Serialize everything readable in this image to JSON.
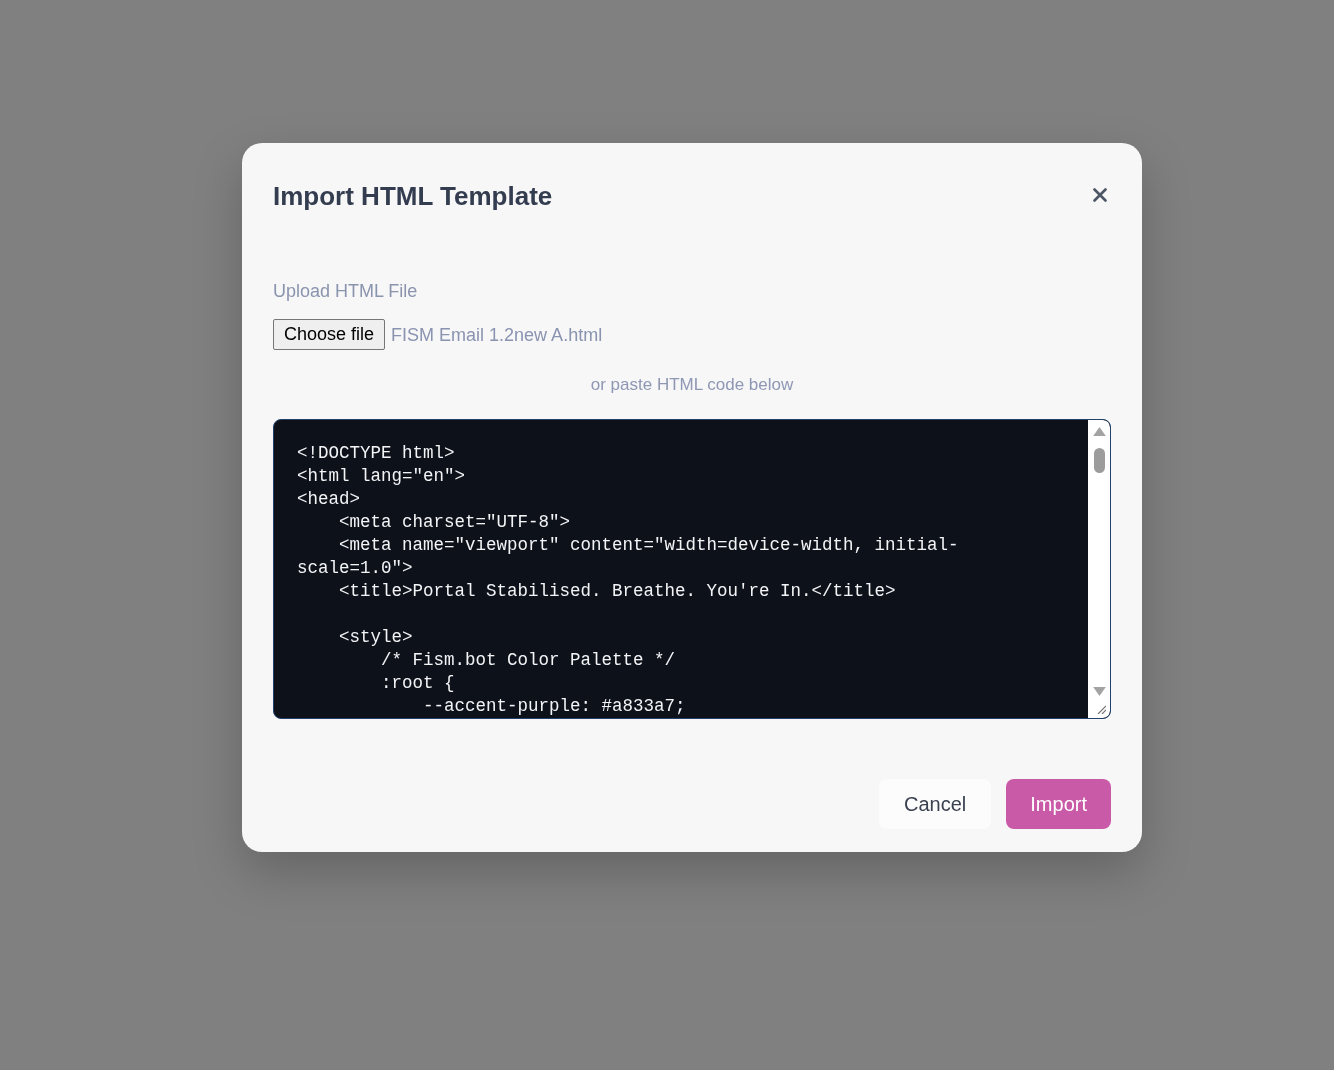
{
  "dialog": {
    "title": "Import HTML Template"
  },
  "upload": {
    "label": "Upload HTML File",
    "button": "Choose file",
    "file_name": "FISM Email 1.2new A.html"
  },
  "paste_hint": "or paste HTML code below",
  "code": {
    "value": "<!DOCTYPE html>\n<html lang=\"en\">\n<head>\n    <meta charset=\"UTF-8\">\n    <meta name=\"viewport\" content=\"width=device-width, initial-scale=1.0\">\n    <title>Portal Stabilised. Breathe. You're In.</title>\n\n    <style>\n        /* Fism.bot Color Palette */\n        :root {\n            --accent-purple: #a833a7;"
  },
  "buttons": [
    {
      "label": "Cancel",
      "kind": "secondary"
    },
    {
      "label": "Import",
      "kind": "primary"
    }
  ]
}
